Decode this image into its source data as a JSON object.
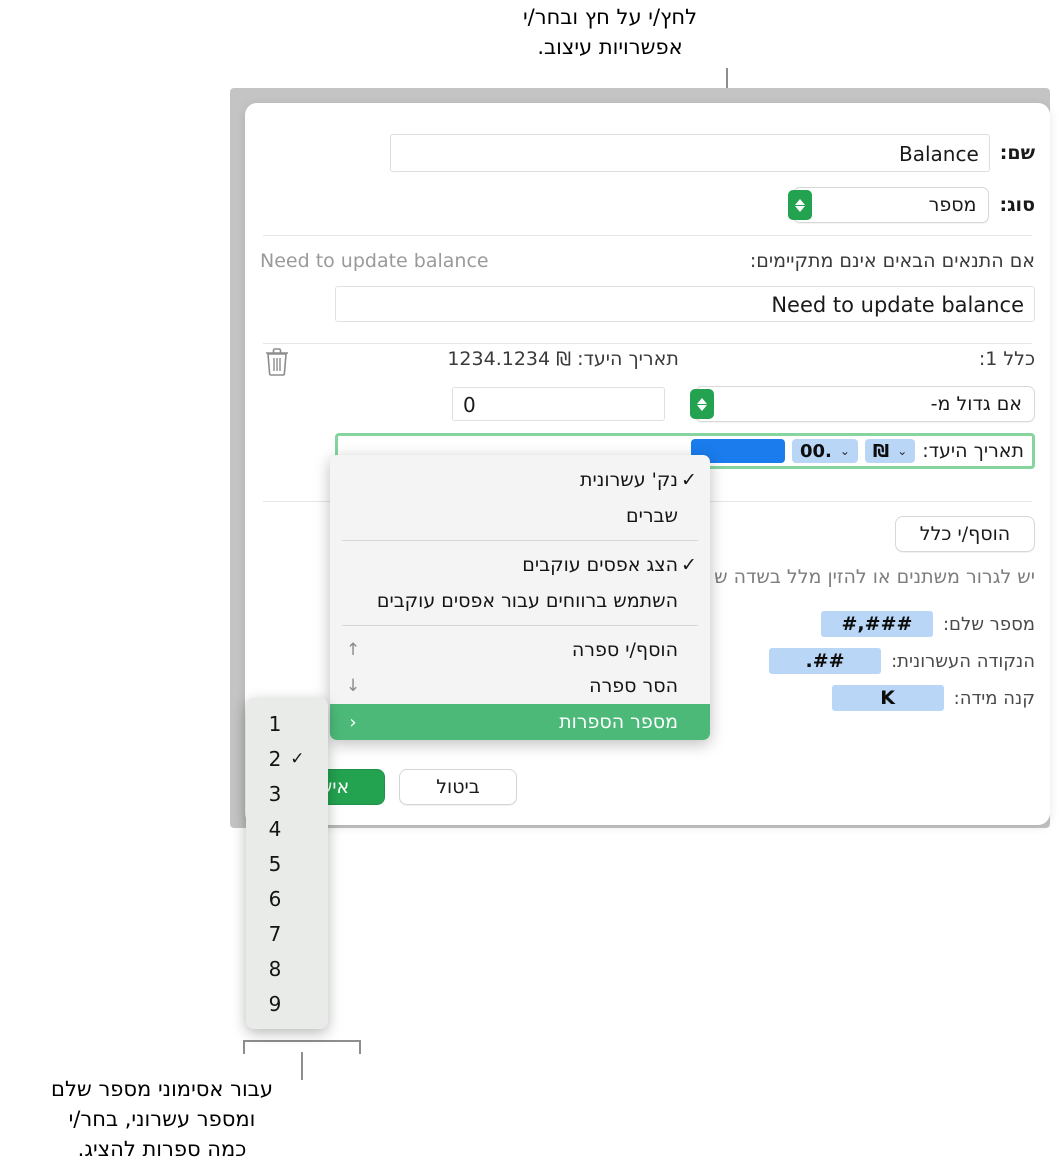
{
  "callouts": {
    "top": "לחץ/י על חץ ובחר/י\nאפשרויות עיצוב.",
    "bottom": "עבור אסימוני מספר שלם\nומספר עשרוני, בחר/י\nכמה ספרות להציג."
  },
  "dialog": {
    "name_label": "שם:",
    "name_value": "Balance",
    "type_label": "סוג:",
    "type_value": "מספר",
    "condition_label": "אם התנאים הבאים אינם מתקיימים:",
    "condition_hint": "Need to update balance",
    "condition_value": "Need to update balance",
    "rule_label": "כלל 1:",
    "rule_preview": "תאריך היעד: ₪ 1234.1234",
    "operator_value": "אם גדול מ-",
    "operator_number": "0",
    "format_label": "תאריך היעד:",
    "format_tokens": [
      {
        "text": "₪",
        "selected": false
      },
      {
        "text": ".00",
        "selected": false
      },
      {
        "text": "",
        "selected": true
      }
    ],
    "add_rule_label": "הוסף/י כלל",
    "drag_hint": "יש לגרור משתנים או להזין מלל בשדה ש",
    "legend": [
      {
        "label": "מספר שלם:",
        "token": "#,###"
      },
      {
        "label": "הנקודה העשרונית:",
        "token": ".##"
      },
      {
        "label": "קנה מידה:",
        "token": "K"
      }
    ],
    "cancel_label": "ביטול",
    "ok_label": "אישור"
  },
  "context_menu": {
    "items": [
      {
        "label": "נק' עשרונית",
        "checked": true,
        "trail": "",
        "highlight": false
      },
      {
        "label": "שברים",
        "checked": false,
        "trail": "",
        "highlight": false
      },
      {
        "separator": true
      },
      {
        "label": "הצג אפסים עוקבים",
        "checked": true,
        "trail": "",
        "highlight": false
      },
      {
        "label": "השתמש ברווחים עבור אפסים עוקבים",
        "checked": false,
        "trail": "",
        "highlight": false
      },
      {
        "separator": true
      },
      {
        "label": "הוסף/י ספרה",
        "checked": false,
        "trail": "↑",
        "highlight": false
      },
      {
        "label": "הסר ספרה",
        "checked": false,
        "trail": "↓",
        "highlight": false
      },
      {
        "label": "מספר הספרות",
        "checked": false,
        "trail": "‹",
        "highlight": true
      }
    ]
  },
  "digits_submenu": {
    "items": [
      {
        "value": "1",
        "checked": false
      },
      {
        "value": "2",
        "checked": true
      },
      {
        "value": "3",
        "checked": false
      },
      {
        "value": "4",
        "checked": false
      },
      {
        "value": "5",
        "checked": false
      },
      {
        "value": "6",
        "checked": false
      },
      {
        "value": "7",
        "checked": false
      },
      {
        "value": "8",
        "checked": false
      },
      {
        "value": "9",
        "checked": false
      }
    ]
  },
  "colors": {
    "accent_green": "#23a34f",
    "highlight_green": "#4cb979",
    "focus_green": "#86d49e",
    "token_blue": "#b9d6f7",
    "selected_blue": "#1a7ced"
  }
}
